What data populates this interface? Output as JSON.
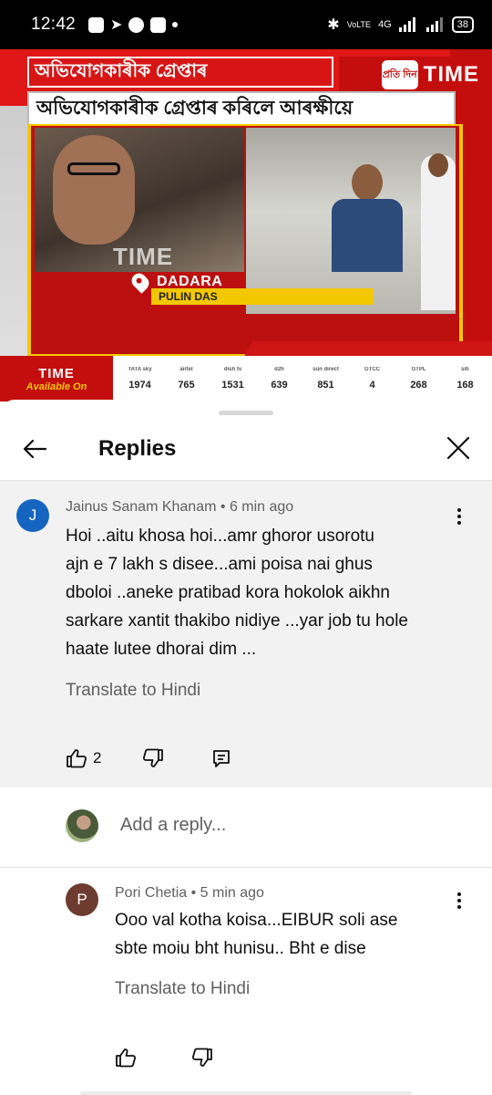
{
  "status_bar": {
    "time": "12:42",
    "network": "4G",
    "battery": "38"
  },
  "video": {
    "headline_top": "অভিযোগকাৰীক গ্ৰেপ্তাৰ",
    "headline_main": "অভিযোগকাৰীক গ্ৰেপ্তাৰ কৰিলে আৰক্ষীয়ে",
    "logo_text": "TIME",
    "logo_mark": "প্ৰতি দিন",
    "watermark": "TIME",
    "location": "DADARA",
    "reporter": "PULIN DAS",
    "available_brand": "TIME",
    "available_label": "Available On",
    "channels": [
      {
        "name": "TATA sky",
        "number": "1974"
      },
      {
        "name": "airtel",
        "number": "765"
      },
      {
        "name": "dish tv",
        "number": "1531"
      },
      {
        "name": "d2h",
        "number": "639"
      },
      {
        "name": "sun direct",
        "number": "851"
      },
      {
        "name": "GTCC",
        "number": "4"
      },
      {
        "name": "GTPL",
        "number": "268"
      },
      {
        "name": "siti",
        "number": "168"
      }
    ]
  },
  "replies_panel": {
    "title": "Replies",
    "parent_comment": {
      "avatar_letter": "J",
      "avatar_color": "#1565c0",
      "author": "Jainus Sanam Khanam",
      "time": "6 min ago",
      "text_lines": [
        "Hoi ..aitu khosa hoi...amr ghoror usorotu",
        "ajn e 7 lakh s disee...ami poisa nai ghus",
        "dboloi ..aneke pratibad kora hokolok aikhn",
        "sarkare xantit thakibo nidiye ...yar job tu hole",
        "haate lutee dhorai dim ..."
      ],
      "translate": "Translate to Hindi",
      "likes": "2"
    },
    "add_reply_placeholder": "Add a reply...",
    "child_comment": {
      "avatar_letter": "P",
      "avatar_color": "#6d3b2f",
      "author": "Pori Chetia",
      "time": "5 min ago",
      "text_lines": [
        "Ooo val kotha koisa...EIBUR soli ase",
        "sbte moiu bht hunisu.. Bht e dise"
      ],
      "translate": "Translate to Hindi"
    }
  }
}
